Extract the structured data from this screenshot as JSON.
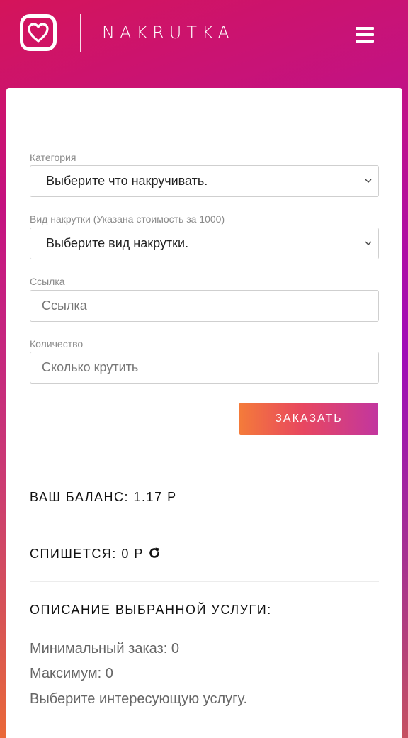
{
  "header": {
    "brand": "NAKRUTKA",
    "logo_icon": "heart-logo-icon",
    "menu_icon": "hamburger-menu-icon"
  },
  "form": {
    "category": {
      "label": "Категория",
      "value": "Выберите что накручивать."
    },
    "service": {
      "label": "Вид накрутки (Указана стоимость за 1000)",
      "value": "Выберите вид накрутки."
    },
    "link": {
      "label": "Ссылка",
      "placeholder": "Ссылка"
    },
    "quantity": {
      "label": "Количество",
      "placeholder": "Сколько крутить"
    },
    "order_button": "ЗАКАЗАТЬ"
  },
  "balance": {
    "text": "ВАШ БАЛАНС: 1.17 Р"
  },
  "charge": {
    "text": "СПИШЕТСЯ: 0 Р",
    "refresh_icon": "refresh-icon"
  },
  "description": {
    "title": "ОПИСАНИЕ ВЫБРАННОЙ УСЛУГИ:",
    "min": "Минимальный заказ: 0",
    "max": "Максимум: 0",
    "hint": "Выберите интересующую услугу."
  },
  "colors": {
    "button_gradient_start": "#f47b3a",
    "button_gradient_end": "#c2369f",
    "header_gradient": "#d4145a"
  }
}
